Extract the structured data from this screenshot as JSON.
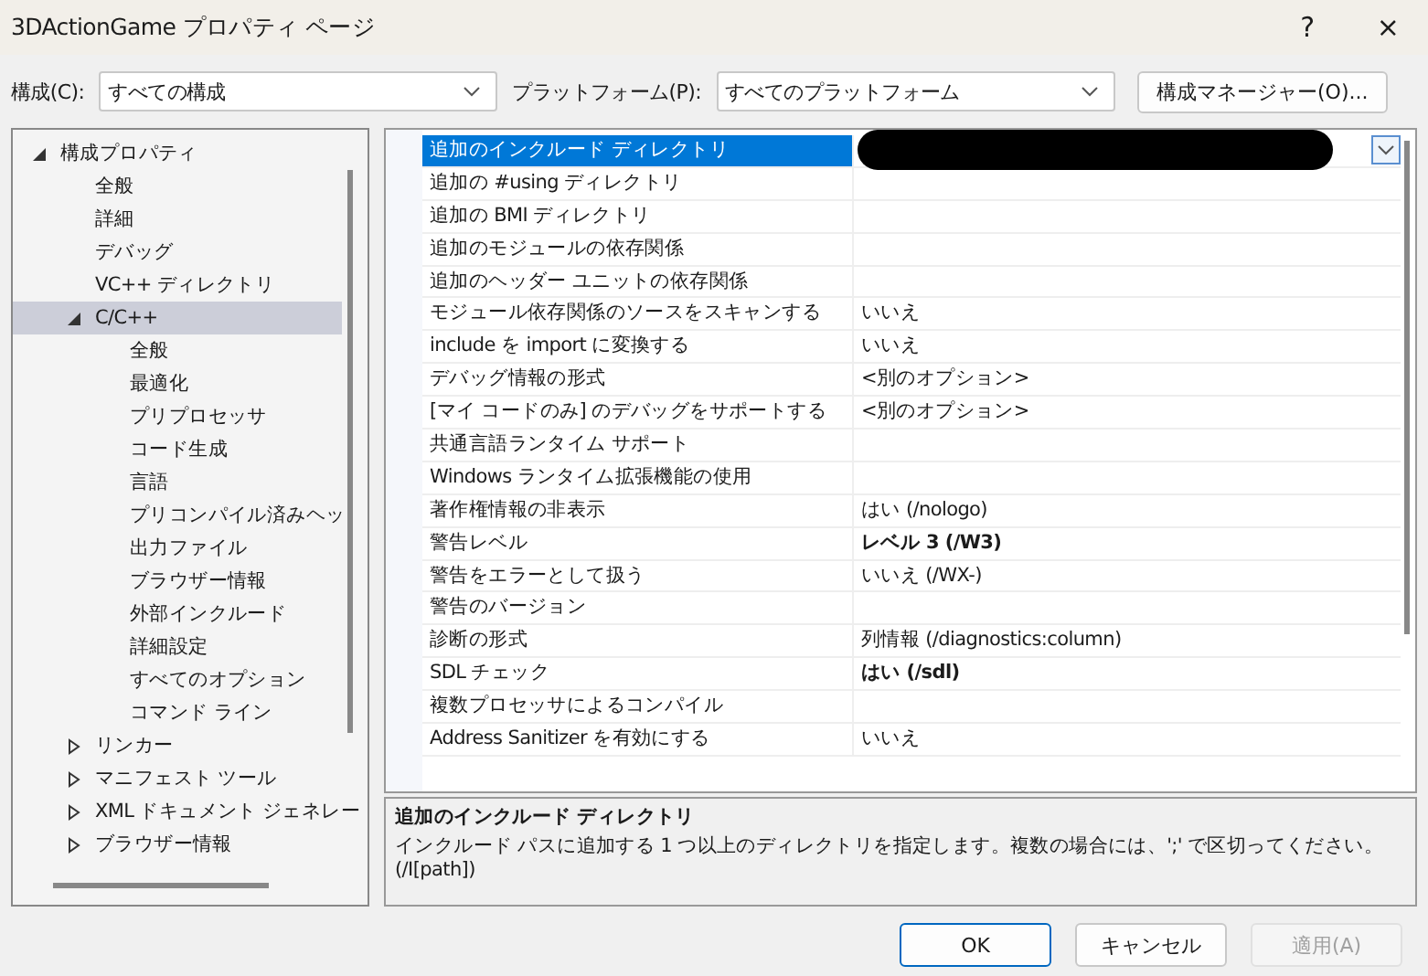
{
  "window": {
    "title": "3DActionGame プロパティ ページ",
    "help": "?",
    "close": "×"
  },
  "toolbar": {
    "configuration_label": "構成(C):",
    "configuration": "すべての構成",
    "platform_label": "プラットフォーム(P):",
    "platform": "すべてのプラットフォーム",
    "manager_button": "構成マネージャー(O)..."
  },
  "tree": [
    {
      "label": "構成プロパティ",
      "expanded": true,
      "selected": false,
      "children": [
        {
          "label": "全般",
          "selected": false
        },
        {
          "label": "詳細",
          "selected": false
        },
        {
          "label": "デバッグ",
          "selected": false
        },
        {
          "label": "VC++ ディレクトリ",
          "selected": false
        },
        {
          "label": "C/C++",
          "expanded": true,
          "selected": true,
          "children": [
            {
              "label": "全般",
              "selected": false
            },
            {
              "label": "最適化",
              "selected": false
            },
            {
              "label": "プリプロセッサ",
              "selected": false
            },
            {
              "label": "コード生成",
              "selected": false
            },
            {
              "label": "言語",
              "selected": false
            },
            {
              "label": "プリコンパイル済みヘッ",
              "selected": false
            },
            {
              "label": "出力ファイル",
              "selected": false
            },
            {
              "label": "ブラウザー情報",
              "selected": false
            },
            {
              "label": "外部インクルード",
              "selected": false
            },
            {
              "label": "詳細設定",
              "selected": false
            },
            {
              "label": "すべてのオプション",
              "selected": false
            },
            {
              "label": "コマンド ライン",
              "selected": false
            }
          ]
        },
        {
          "label": "リンカー",
          "expanded": false,
          "selected": false
        },
        {
          "label": "マニフェスト ツール",
          "expanded": false,
          "selected": false
        },
        {
          "label": "XML ドキュメント ジェネレー",
          "expanded": false,
          "selected": false
        },
        {
          "label": "ブラウザー情報",
          "expanded": false,
          "selected": false
        }
      ]
    }
  ],
  "properties": [
    {
      "name": "追加のインクルード ディレクトリ",
      "selected": true,
      "redacted": true
    },
    {
      "name": "追加の #using ディレクトリ",
      "selected": false
    },
    {
      "name": "追加の BMI ディレクトリ",
      "selected": false
    },
    {
      "name": "追加のモジュールの依存関係",
      "selected": false
    },
    {
      "name": "追加のヘッダー ユニットの依存関係",
      "selected": false
    },
    {
      "name": "モジュール依存関係のソースをスキャンする",
      "value": "いいえ",
      "selected": false
    },
    {
      "name": "include を import に変換する",
      "value": "いいえ",
      "selected": false
    },
    {
      "name": "デバッグ情報の形式",
      "value": "<別のオプション>",
      "selected": false
    },
    {
      "name": "[マイ コードのみ] のデバッグをサポートする",
      "value": "<別のオプション>",
      "selected": false
    },
    {
      "name": "共通言語ランタイム サポート",
      "selected": false
    },
    {
      "name": "Windows ランタイム拡張機能の使用",
      "selected": false
    },
    {
      "name": "著作権情報の非表示",
      "value": "はい (/nologo)",
      "selected": false
    },
    {
      "name": "警告レベル",
      "value": "レベル 3 (/W3)",
      "bold": true,
      "selected": false
    },
    {
      "name": "警告をエラーとして扱う",
      "value": "いいえ (/WX-)",
      "selected": false
    },
    {
      "name": "警告のバージョン",
      "selected": false
    },
    {
      "name": "診断の形式",
      "value": "列情報 (/diagnostics:column)",
      "selected": false
    },
    {
      "name": "SDL チェック",
      "value": "はい (/sdl)",
      "bold": true,
      "selected": false
    },
    {
      "name": "複数プロセッサによるコンパイル",
      "selected": false
    },
    {
      "name": "Address Sanitizer を有効にする",
      "value": "いいえ",
      "selected": false
    }
  ],
  "description": {
    "title": "追加のインクルード ディレクトリ",
    "text": "インクルード パスに追加する 1 つ以上のディレクトリを指定します。複数の場合には、';' で区切ってください。(/I[path])"
  },
  "buttons": [
    {
      "label": "OK",
      "focused": true,
      "disabled": false
    },
    {
      "label": "キャンセル",
      "focused": false,
      "disabled": false
    },
    {
      "label": "適用(A)",
      "focused": false,
      "disabled": true
    }
  ]
}
